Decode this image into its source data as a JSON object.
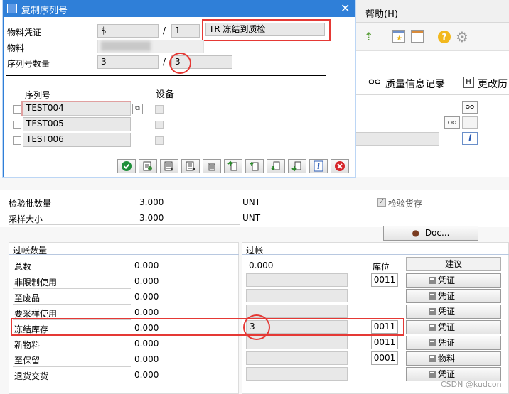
{
  "menu": {
    "help": "帮助(H)"
  },
  "tabs": {
    "quality_info": "质量信息记录",
    "change_history": "更改历"
  },
  "dialog": {
    "title": "复制序列号",
    "material_doc_label": "物料凭证",
    "material_doc_value": "$",
    "material_doc_sep": "/",
    "material_doc_item": "1",
    "movement_type_value": "TR 冻结到质检",
    "material_label": "物料",
    "material_value": "",
    "serial_count_label": "序列号数量",
    "serial_count_value": "3",
    "serial_count_sep": "/",
    "serial_count_total": "3",
    "col_serial": "序列号",
    "col_equipment": "设备",
    "serials": [
      "TEST004",
      "TEST005",
      "TEST006"
    ]
  },
  "inspection": {
    "lot_qty_label": "检验批数量",
    "lot_qty_value": "3.000",
    "lot_qty_unit": "UNT",
    "sample_size_label": "采样大小",
    "sample_size_value": "3.000",
    "sample_size_unit": "UNT",
    "inspection_stock_label": "检验货存",
    "doc_button": "Doc..."
  },
  "posting_qty": {
    "header": "过帐数量",
    "rows": [
      {
        "label": "总数",
        "value": "0.000"
      },
      {
        "label": "非限制使用",
        "value": "0.000"
      },
      {
        "label": "至废品",
        "value": "0.000"
      },
      {
        "label": "要采样使用",
        "value": "0.000"
      },
      {
        "label": "冻结库存",
        "value": "0.000"
      },
      {
        "label": "新物料",
        "value": "0.000"
      },
      {
        "label": "至保留",
        "value": "0.000"
      },
      {
        "label": "退货交货",
        "value": "0.000"
      }
    ]
  },
  "posting": {
    "header": "过帐",
    "total_value": "0.000",
    "storage_loc_header": "库位",
    "proposal_header": "建议",
    "blocked_value": "3",
    "locations": [
      "0011",
      "",
      "",
      "",
      "0011",
      "0011",
      "0001",
      ""
    ],
    "buttons": [
      "凭证",
      "凭证",
      "凭证",
      "凭证",
      "凭证",
      "物料",
      "凭证",
      "凭证"
    ]
  },
  "watermark": "CSDN @kudcon"
}
